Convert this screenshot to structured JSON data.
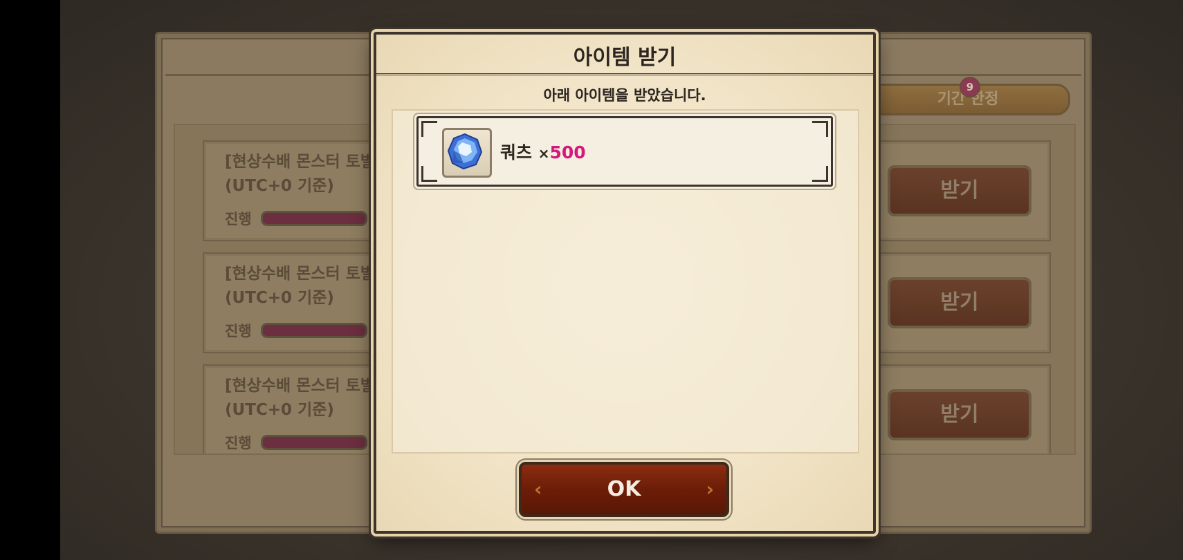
{
  "background_panel": {
    "tab_label": "기간 한정",
    "tab_badge": "9",
    "quests": [
      {
        "title": "[현상수배 몬스터 토벌]",
        "subtitle": "(UTC+0 기준)",
        "progress_label": "진행",
        "claim_label": "받기"
      },
      {
        "title": "[현상수배 몬스터 토벌]",
        "subtitle": "(UTC+0 기준)",
        "progress_label": "진행",
        "claim_label": "받기"
      },
      {
        "title": "[현상수배 몬스터 토벌]",
        "subtitle": "(UTC+0 기준)",
        "progress_label": "진행",
        "claim_label": "받기"
      }
    ]
  },
  "dialog": {
    "title": "아이템 받기",
    "message": "아래 아이템을 받았습니다.",
    "item": {
      "name": "쿼츠",
      "multiplier": "×",
      "quantity": "500",
      "icon": "quartz-gem-icon"
    },
    "ok_label": "OK"
  },
  "colors": {
    "quantity": "#d4197a",
    "ok_button": "#7a2410",
    "parchment": "#f1e4c7"
  }
}
